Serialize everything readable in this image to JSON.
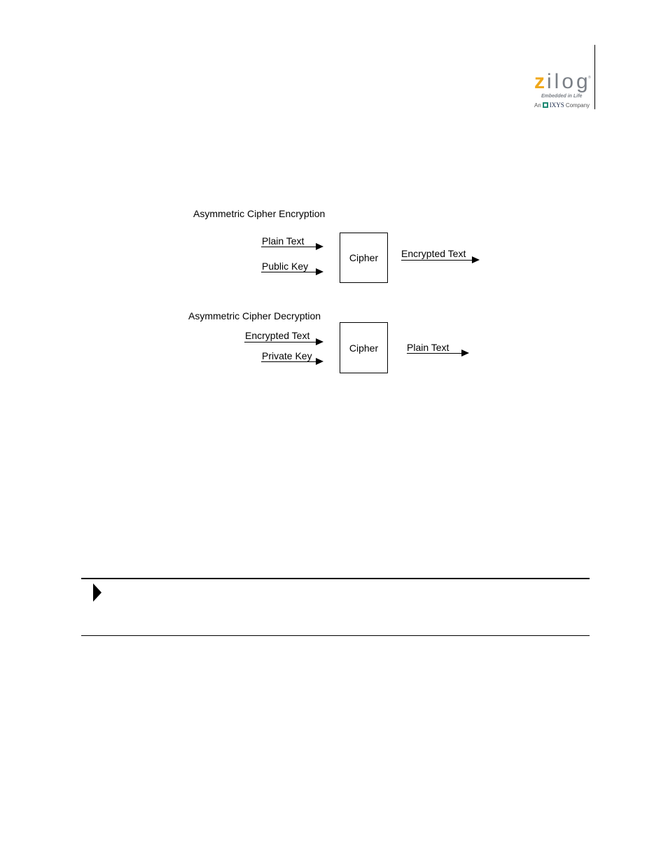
{
  "header": {
    "logo": {
      "brand_first_letter": "z",
      "brand_rest": "ilog",
      "trademark": "®",
      "tagline": "Embedded in Life",
      "parent_prefix": "An",
      "parent_name": "IXYS",
      "parent_suffix": "Company",
      "colors": {
        "z": "#f0a81c",
        "text": "#7a7f86",
        "ixys": "#1f8a74"
      }
    }
  },
  "diagram": {
    "encryption": {
      "title": "Asymmetric Cipher Encryption",
      "inputs": [
        "Plain Text",
        "Public Key"
      ],
      "block": "Cipher",
      "output": "Encrypted Text"
    },
    "decryption": {
      "title": "Asymmetric Cipher Decryption",
      "inputs": [
        "Encrypted Text",
        "Private Key"
      ],
      "block": "Cipher",
      "output": "Plain Text"
    }
  },
  "note": {
    "icon": "note-arrow-icon"
  }
}
